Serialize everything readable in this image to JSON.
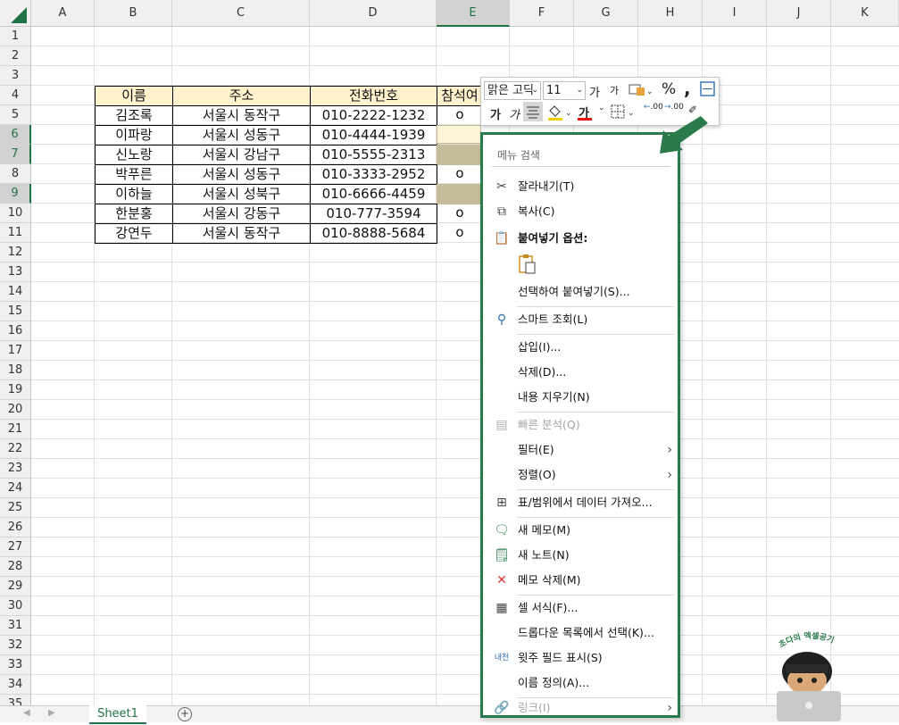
{
  "columns": [
    "A",
    "B",
    "C",
    "D",
    "E",
    "F",
    "G",
    "H",
    "I",
    "J",
    "K"
  ],
  "rows": [
    "1",
    "2",
    "3",
    "4",
    "5",
    "6",
    "7",
    "8",
    "9",
    "10",
    "11",
    "12",
    "13",
    "14",
    "15",
    "16",
    "17",
    "18",
    "19",
    "20",
    "21",
    "22",
    "23",
    "24",
    "25",
    "26",
    "27",
    "28",
    "29",
    "30",
    "31",
    "32",
    "33",
    "34",
    "35"
  ],
  "table": {
    "headers": [
      "이름",
      "주소",
      "전화번호",
      "참석여"
    ],
    "rows": [
      {
        "name": "김조록",
        "addr": "서울시 동작구",
        "phone": "010-2222-1232",
        "att": "o"
      },
      {
        "name": "이파랑",
        "addr": "서울시 성동구",
        "phone": "010-4444-1939",
        "att": ""
      },
      {
        "name": "신노랑",
        "addr": "서울시 강남구",
        "phone": "010-5555-2313",
        "att": ""
      },
      {
        "name": "박푸른",
        "addr": "서울시 성동구",
        "phone": "010-3333-2952",
        "att": "o"
      },
      {
        "name": "이하늘",
        "addr": "서울시 성북구",
        "phone": "010-6666-4459",
        "att": ""
      },
      {
        "name": "한분홍",
        "addr": "서울시 강동구",
        "phone": "010-777-3594",
        "att": "o"
      },
      {
        "name": "강연두",
        "addr": "서울시 동작구",
        "phone": "010-8888-5684",
        "att": "o"
      }
    ]
  },
  "mini_toolbar": {
    "font_name": "맑은 고딕",
    "font_size": "11",
    "grow": "가",
    "shrink": "가",
    "percent": "%",
    "comma": ",",
    "bold": "가",
    "italic": "가",
    "font_color_glyph": "가",
    "decimal_inc": ".00",
    "decimal_dec": ".00"
  },
  "context_menu": {
    "search_placeholder": "메뉴 검색",
    "items": {
      "cut": "잘라내기(T)",
      "copy": "복사(C)",
      "paste_options": "붙여넣기 옵션:",
      "paste_special": "선택하여 붙여넣기(S)...",
      "smart_lookup": "스마트 조회(L)",
      "insert": "삽입(I)...",
      "delete": "삭제(D)...",
      "clear": "내용 지우기(N)",
      "quick_analysis": "빠른 분석(Q)",
      "filter": "필터(E)",
      "sort": "정렬(O)",
      "get_data": "표/범위에서 데이터 가져오...",
      "new_comment": "새 메모(M)",
      "new_note": "새 노트(N)",
      "delete_comment": "메모 삭제(M)",
      "format_cells": "셀 서식(F)...",
      "pick_dropdown": "드롭다운 목록에서 선택(K)...",
      "phonetic": "윗주 필드 표시(S)",
      "define_name": "이름 정의(A)...",
      "link": "링크(I)"
    }
  },
  "sheet_tab": "Sheet1",
  "avatar_caption": "초다의 엑셀공기",
  "colors": {
    "accent": "#217346",
    "menu_border": "#2a7a4b",
    "header_fill": "#fff2cc",
    "tan_fill": "#c4bd97"
  }
}
